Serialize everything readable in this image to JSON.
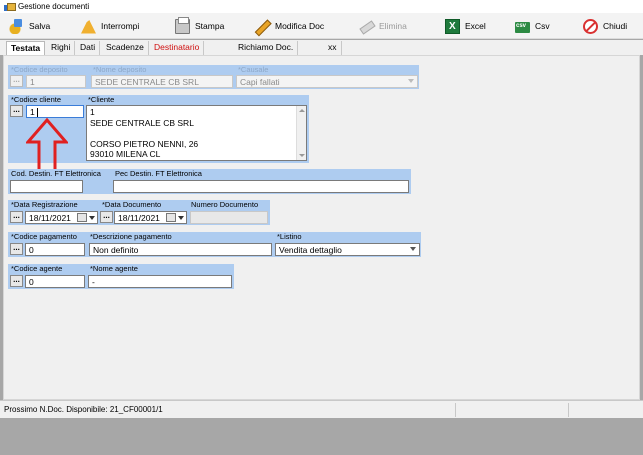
{
  "window": {
    "title": "Gestione documenti"
  },
  "toolbar": {
    "save": "Salva",
    "stop": "Interrompi",
    "print": "Stampa",
    "edit": "Modifica Doc",
    "delete": "Elimina",
    "excel": "Excel",
    "csv": "Csv",
    "close": "Chiudi"
  },
  "tabs": [
    "Testata",
    "Righi",
    "Dati",
    "Scadenze",
    "Destinatario",
    "Richiamo Doc.",
    "xx"
  ],
  "form": {
    "codice_deposito": {
      "label": "*Codice deposito",
      "value": "1"
    },
    "nome_deposito": {
      "label": "*Nome deposito",
      "value": "SEDE CENTRALE CB SRL"
    },
    "causale": {
      "label": "*Causale",
      "value": "Capi fallati"
    },
    "codice_cliente": {
      "label": "*Codice cliente",
      "value": "1"
    },
    "cliente": {
      "label": "*Cliente",
      "lines": [
        "1",
        "SEDE CENTRALE CB SRL",
        "",
        "CORSO PIETRO NENNI, 26",
        "93010 MILENA CL"
      ]
    },
    "cod_destin": {
      "label": "Cod. Destin. FT Elettronica",
      "value": ""
    },
    "pec_destin": {
      "label": "Pec Destin. FT Elettronica",
      "value": ""
    },
    "data_registrazione": {
      "label": "*Data Registrazione",
      "value": "18/11/2021"
    },
    "data_documento": {
      "label": "*Data Documento",
      "value": "18/11/2021"
    },
    "numero_documento": {
      "label": "Numero Documento",
      "value": ""
    },
    "codice_pagamento": {
      "label": "*Codice pagamento",
      "value": "0"
    },
    "descrizione_pagamento": {
      "label": "*Descrizione pagamento",
      "value": "Non definito"
    },
    "listino": {
      "label": "*Listino",
      "value": "Vendita dettaglio"
    },
    "codice_agente": {
      "label": "*Codice agente",
      "value": "0"
    },
    "nome_agente": {
      "label": "*Nome agente",
      "value": "-"
    },
    "dots": "..."
  },
  "status": {
    "text": "Prossimo N.Doc. Disponibile: 21_CF00001/1"
  },
  "colors": {
    "label_band": "#aeccf0",
    "annotation_arrow": "#e02020"
  },
  "icons": [
    "app-icon",
    "save-icon",
    "stop-icon",
    "print-icon",
    "edit-icon",
    "delete-icon",
    "excel-icon",
    "csv-icon",
    "close-icon",
    "calendar-icon",
    "annotation-arrow"
  ]
}
